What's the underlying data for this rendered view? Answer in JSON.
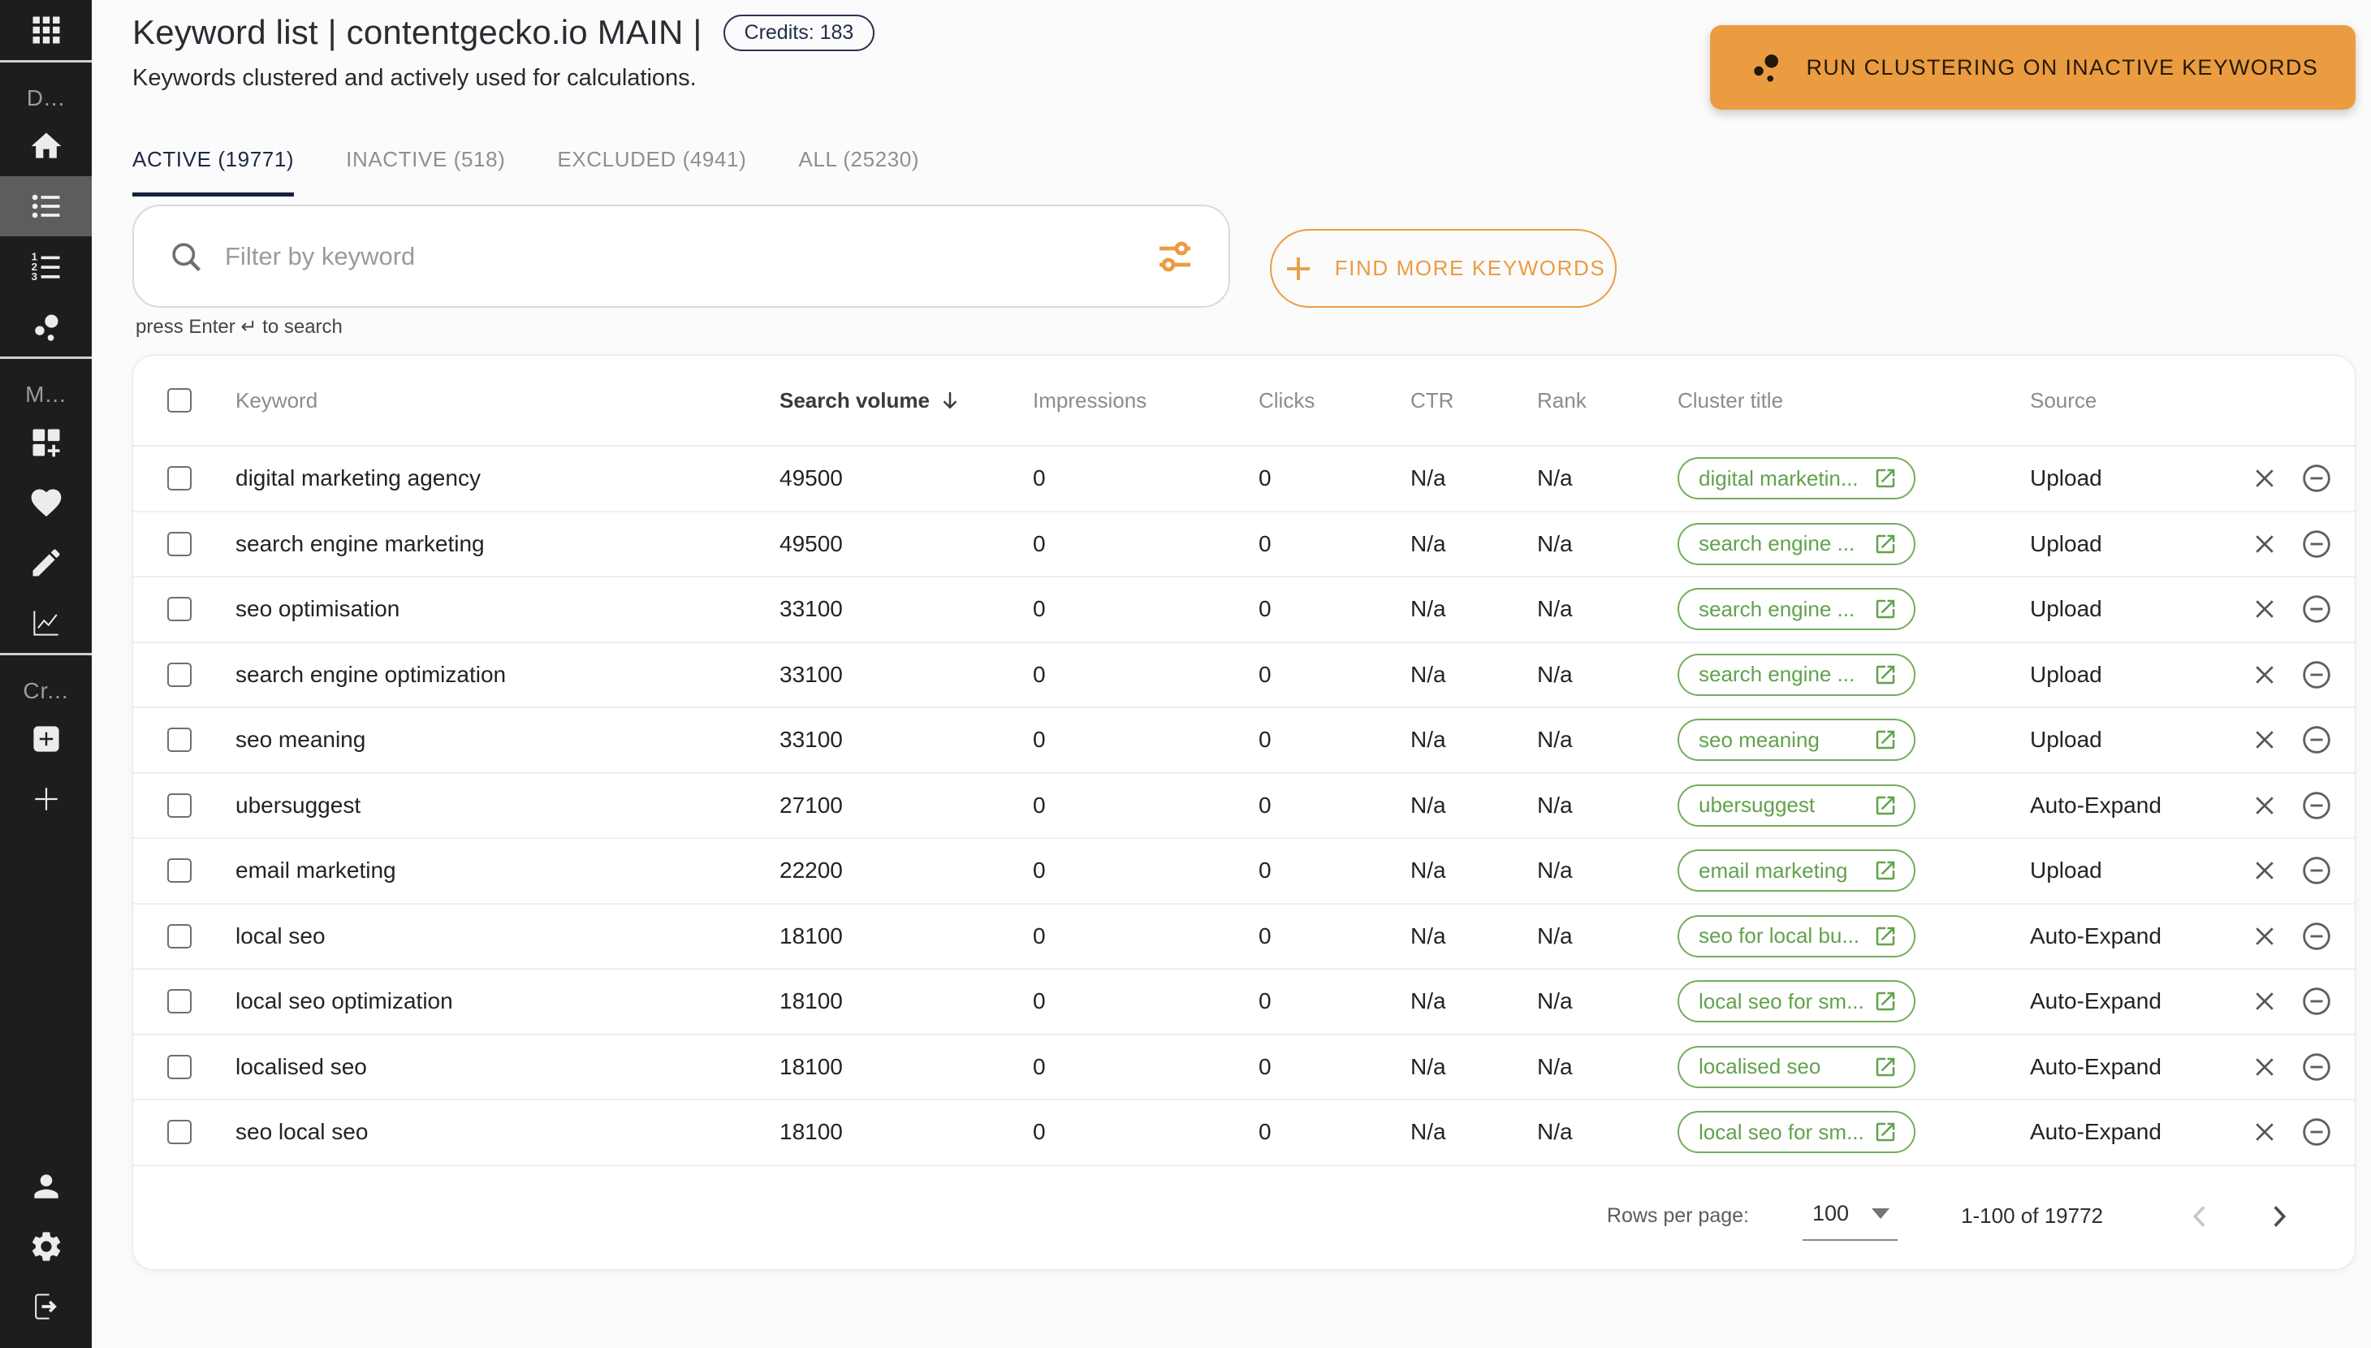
{
  "colors": {
    "accent_orange": "#EB9C41",
    "chip_green": "#61a24c",
    "navy": "#1c2844",
    "sidebar_bg": "#1d1d1d"
  },
  "header": {
    "title": "Keyword list | contentgecko.io MAIN |",
    "credits_badge": "Credits: 183",
    "subtitle": "Keywords clustered and actively used for calculations.",
    "run_clustering_label": "RUN CLUSTERING ON INACTIVE KEYWORDS"
  },
  "tabs": [
    {
      "label": "ACTIVE (19771)",
      "active": true
    },
    {
      "label": "INACTIVE (518)",
      "active": false
    },
    {
      "label": "EXCLUDED (4941)",
      "active": false
    },
    {
      "label": "ALL (25230)",
      "active": false
    }
  ],
  "filter": {
    "placeholder": "Filter by keyword",
    "hint": "press Enter ↵ to search",
    "find_more_label": "FIND MORE KEYWORDS"
  },
  "table": {
    "columns": {
      "keyword": "Keyword",
      "volume": "Search volume",
      "impressions": "Impressions",
      "clicks": "Clicks",
      "ctr": "CTR",
      "rank": "Rank",
      "cluster": "Cluster title",
      "source": "Source"
    },
    "sorted_column": "Search volume",
    "sort_direction": "desc",
    "rows": [
      {
        "keyword": "digital marketing agency",
        "volume": "49500",
        "impressions": "0",
        "clicks": "0",
        "ctr": "N/a",
        "rank": "N/a",
        "cluster": "digital marketin...",
        "source": "Upload"
      },
      {
        "keyword": "search engine marketing",
        "volume": "49500",
        "impressions": "0",
        "clicks": "0",
        "ctr": "N/a",
        "rank": "N/a",
        "cluster": "search engine ...",
        "source": "Upload"
      },
      {
        "keyword": "seo optimisation",
        "volume": "33100",
        "impressions": "0",
        "clicks": "0",
        "ctr": "N/a",
        "rank": "N/a",
        "cluster": "search engine ...",
        "source": "Upload"
      },
      {
        "keyword": "search engine optimization",
        "volume": "33100",
        "impressions": "0",
        "clicks": "0",
        "ctr": "N/a",
        "rank": "N/a",
        "cluster": "search engine ...",
        "source": "Upload"
      },
      {
        "keyword": "seo meaning",
        "volume": "33100",
        "impressions": "0",
        "clicks": "0",
        "ctr": "N/a",
        "rank": "N/a",
        "cluster": "seo meaning",
        "source": "Upload"
      },
      {
        "keyword": "ubersuggest",
        "volume": "27100",
        "impressions": "0",
        "clicks": "0",
        "ctr": "N/a",
        "rank": "N/a",
        "cluster": "ubersuggest",
        "source": "Auto-Expand"
      },
      {
        "keyword": "email marketing",
        "volume": "22200",
        "impressions": "0",
        "clicks": "0",
        "ctr": "N/a",
        "rank": "N/a",
        "cluster": "email marketing",
        "source": "Upload"
      },
      {
        "keyword": "local seo",
        "volume": "18100",
        "impressions": "0",
        "clicks": "0",
        "ctr": "N/a",
        "rank": "N/a",
        "cluster": "seo for local bu...",
        "source": "Auto-Expand"
      },
      {
        "keyword": "local seo optimization",
        "volume": "18100",
        "impressions": "0",
        "clicks": "0",
        "ctr": "N/a",
        "rank": "N/a",
        "cluster": "local seo for sm...",
        "source": "Auto-Expand"
      },
      {
        "keyword": "localised seo",
        "volume": "18100",
        "impressions": "0",
        "clicks": "0",
        "ctr": "N/a",
        "rank": "N/a",
        "cluster": "localised seo",
        "source": "Auto-Expand"
      },
      {
        "keyword": "seo local seo",
        "volume": "18100",
        "impressions": "0",
        "clicks": "0",
        "ctr": "N/a",
        "rank": "N/a",
        "cluster": "local seo for sm...",
        "source": "Auto-Expand"
      }
    ]
  },
  "pagination": {
    "rows_per_page_label": "Rows per page:",
    "rows_per_page": "100",
    "range": "1-100 of 19772"
  },
  "sidebar": {
    "section_labels": {
      "first": "D...",
      "second": "M...",
      "third": "Cr..."
    },
    "icons": [
      "apps",
      "home",
      "keyword-list",
      "numbered-list",
      "clusters",
      "dashboard-add",
      "favorites",
      "edit",
      "analytics",
      "add-box",
      "add",
      "account",
      "settings",
      "logout"
    ]
  }
}
